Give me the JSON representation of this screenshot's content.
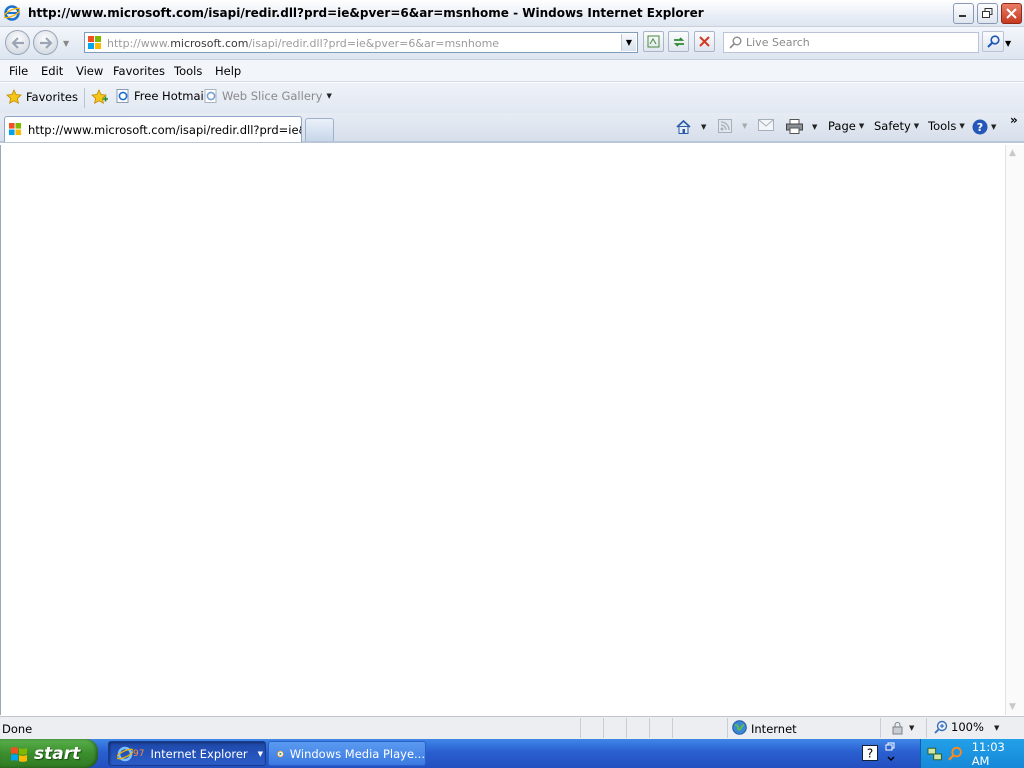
{
  "window": {
    "title": "http://www.microsoft.com/isapi/redir.dll?prd=ie&pver=6&ar=msnhome - Windows Internet Explorer"
  },
  "address": {
    "url_prefix": "http://www.",
    "url_domain": "microsoft.com",
    "url_path": "/isapi/redir.dll?prd=ie&pver=6&ar=msnhome"
  },
  "search": {
    "placeholder": "Live Search"
  },
  "menu": [
    "File",
    "Edit",
    "View",
    "Favorites",
    "Tools",
    "Help"
  ],
  "favorites_bar": {
    "favorites_label": "Favorites",
    "items": [
      "Free Hotmail",
      "Web Slice Gallery"
    ]
  },
  "tabs": {
    "active_tab_label": "http://www.microsoft.com/isapi/redir.dll?prd=ie&pver..."
  },
  "command_bar": {
    "page": "Page",
    "safety": "Safety",
    "tools": "Tools"
  },
  "status_bar": {
    "status": "Done",
    "zone": "Internet",
    "zoom": "100%"
  },
  "taskbar": {
    "start_label": "start",
    "tasks": [
      {
        "label": "Internet Explorer",
        "badge": "97"
      },
      {
        "label": "Windows Media Playe..."
      }
    ],
    "clock": "11:03 AM"
  },
  "colors": {
    "taskbar_blue": "#2a5fd0",
    "start_green": "#3b8e2e",
    "close_red": "#c7391f"
  }
}
